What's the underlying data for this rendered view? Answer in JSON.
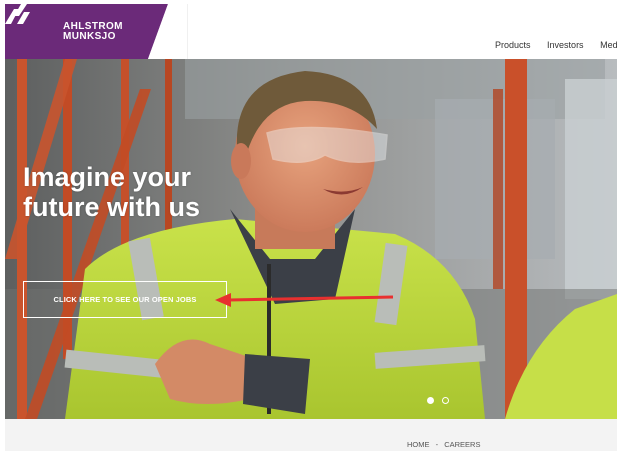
{
  "brand": {
    "line1": "AHLSTROM",
    "line2": "MUNKSJO",
    "color": "#6b2a79"
  },
  "nav": {
    "items": [
      "Products",
      "Investors",
      "Med"
    ]
  },
  "hero": {
    "title_line1": "Imagine your",
    "title_line2": "future with us",
    "cta_label": "CLICK HERE TO SEE OUR OPEN JOBS",
    "arrow_color": "#e8302f",
    "slide_count": 2,
    "active_slide": 1
  },
  "breadcrumb": {
    "home": "HOME",
    "separator": "-",
    "current": "CAREERS"
  }
}
